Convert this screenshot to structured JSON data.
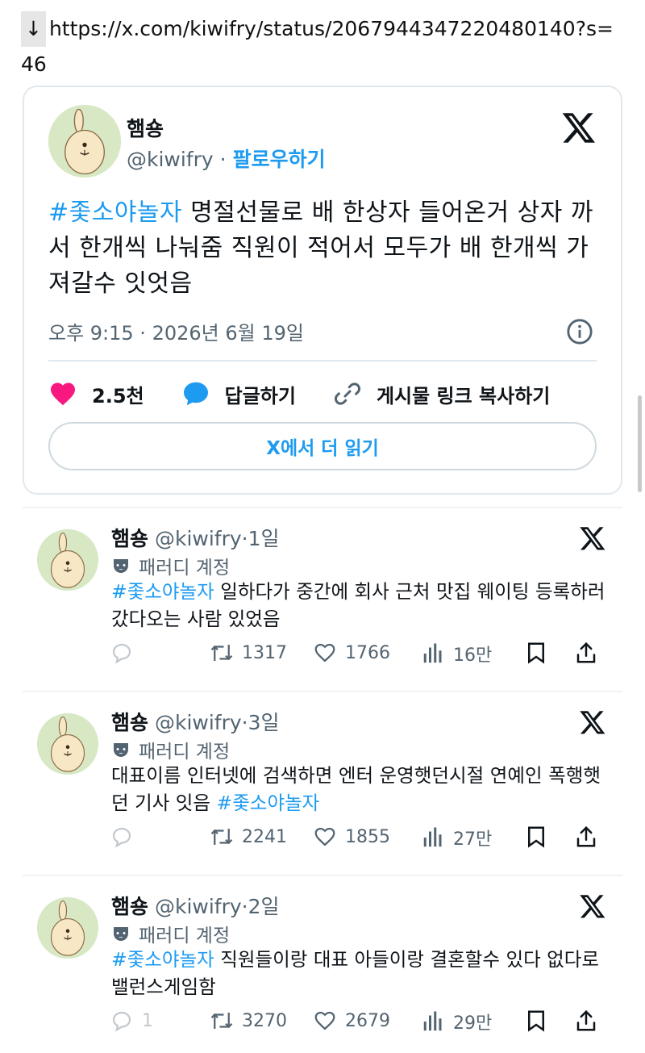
{
  "url": {
    "arrow": "↓",
    "text": "https://x.com/kiwifry/status/2067944347220480140?s=46"
  },
  "embed": {
    "name": "햄숑",
    "handle": "@kiwifry",
    "separator": "·",
    "follow_label": "팔로우하기",
    "hashtag": "#좇소야놀자",
    "text": " 명절선물로 배 한상자 들어온거 상자 까서 한개씩 나눠줌 직원이 적어서 모두가 배 한개씩 가져갈수 잇엇음",
    "timestamp": "오후 9:15 · 2026년 6월 19일",
    "likes": "2.5천",
    "reply_label": "답글하기",
    "copy_link_label": "게시물 링크 복사하기",
    "read_more_label": "X에서 더 읽기",
    "colors": {
      "accent": "#1d9bf0",
      "like": "#f91880",
      "avatar_bg": "#d8e8c4"
    }
  },
  "tweets": [
    {
      "name": "햄숑",
      "handle": "@kiwifry",
      "age": "·1일",
      "parody_label": "패러디 계정",
      "hashtag": "#좇소야놀자",
      "text": " 일하다가 중간에 회사 근처 맛집 웨이팅 등록하러 갔다오는 사람 있었음",
      "replies": "",
      "retweets": "1317",
      "likes": "1766",
      "views": "16만"
    },
    {
      "name": "햄숑",
      "handle": "@kiwifry",
      "age": "·3일",
      "parody_label": "패러디 계정",
      "text": "대표이름 인터넷에 검색하면 엔터 운영햇던시절 연예인 폭행햇던 기사 잇음 ",
      "hashtag": "#좇소야놀자",
      "replies": "",
      "retweets": "2241",
      "likes": "1855",
      "views": "27만"
    },
    {
      "name": "햄숑",
      "handle": "@kiwifry",
      "age": "·2일",
      "parody_label": "패러디 계정",
      "hashtag": "#좇소야놀자",
      "text": " 직원들이랑 대표 아들이랑 결혼할수 있다 없다로 밸런스게임함",
      "replies": "1",
      "retweets": "3270",
      "likes": "2679",
      "views": "29만"
    }
  ]
}
